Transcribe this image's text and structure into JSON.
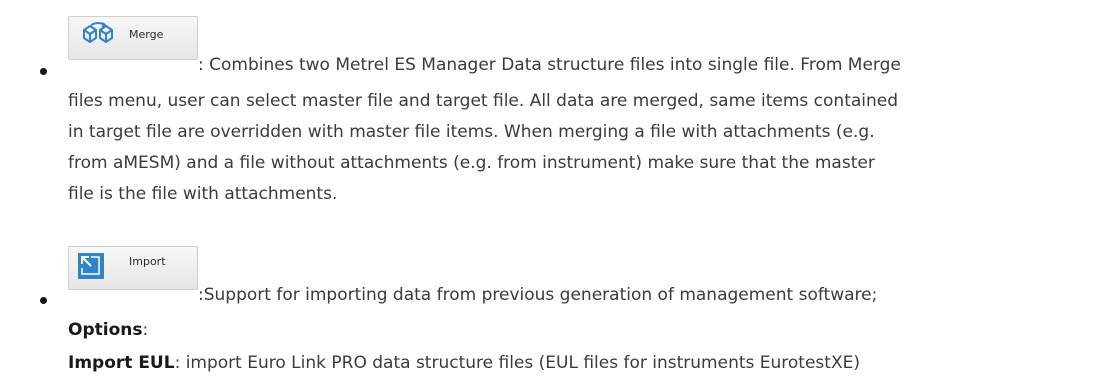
{
  "merge": {
    "button_label": "Merge",
    "icon": "merge-boxes-icon",
    "line1": ": Combines two Metrel ES Manager Data structure files into single file. From Merge",
    "line2": "files menu, user can select master file and target file. All data are merged, same items contained",
    "line3": "in target file are overridden with master file items. When merging a file with attachments (e.g.",
    "line4": "from aMESM) and a file without attachments (e.g. from instrument) make sure that the master",
    "line5": "file is the file with attachments."
  },
  "import": {
    "button_label": "Import",
    "icon": "import-arrow-icon",
    "line1": ":Support for importing data from previous generation of management software;",
    "options_label": "Options",
    "options_colon": ":",
    "eul_term": "Import EUL",
    "eul_text": ": import Euro Link PRO data structure files (EUL files for instruments EurotestXE)"
  },
  "colors": {
    "icon_blue": "#2f84c7",
    "text": "#3b3b3b"
  }
}
